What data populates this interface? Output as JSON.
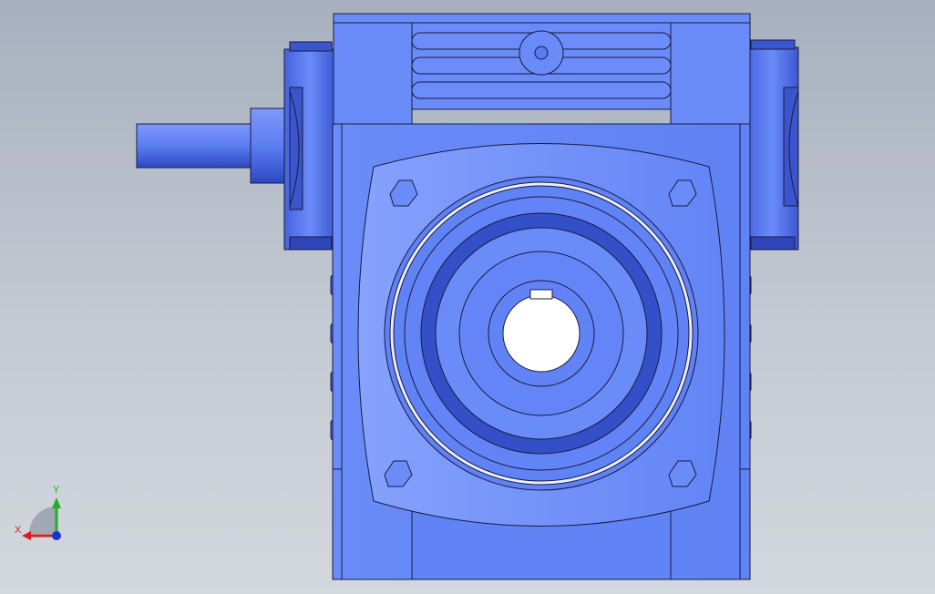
{
  "viewport": {
    "background_top": "#a7b0bf",
    "background_bottom": "#d3d7de"
  },
  "model": {
    "body_color": "#6688f8",
    "body_light": "#7f9cfc",
    "body_mid": "#5a7cf0",
    "body_dark": "#3450c8",
    "outline_color": "#1a1a40",
    "bore_color": "#ffffff"
  },
  "triad": {
    "x_label": "X",
    "y_label": "Y",
    "x_color": "#d42020",
    "y_color": "#20b020",
    "z_color": "#2030d0"
  }
}
